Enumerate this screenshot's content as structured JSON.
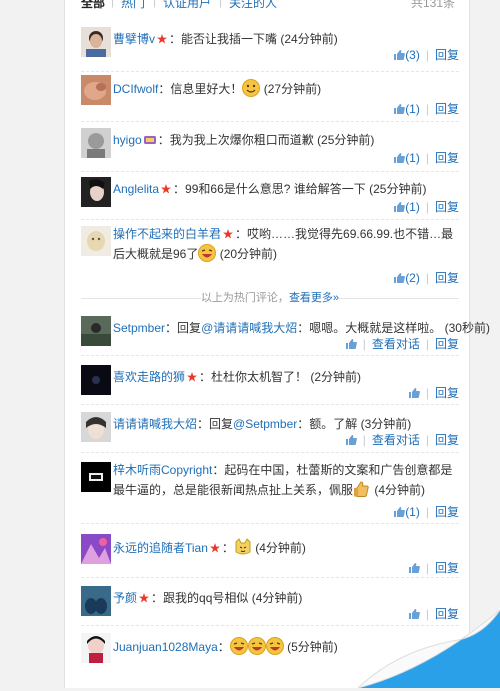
{
  "tabs": [
    {
      "label": "全部",
      "active": true
    },
    {
      "label": "热门",
      "active": false
    },
    {
      "label": "认证用户",
      "active": false
    },
    {
      "label": "关注的人",
      "active": false
    }
  ],
  "total_label": "共131条",
  "hot_divider": {
    "text": "以上为热门评论，",
    "more": "查看更多»"
  },
  "actions": {
    "reply": "回复",
    "view_thread": "查看对话"
  },
  "hot_comments": [
    {
      "user": "曹擘博v",
      "text": "能否让我插一下嘴",
      "time": "(24分钟前)",
      "likes": "(3)"
    },
    {
      "user": "DCIfwolf",
      "text": "信息里好大！",
      "time": "(27分钟前)",
      "likes": "(1)",
      "emoji": "smile"
    },
    {
      "user": "hyigo",
      "text": "我为我上次爆你粗口而道歉",
      "time": "(25分钟前)",
      "likes": "(1)"
    },
    {
      "user": "Anglelita",
      "text": "99和66是什么意思? 谁给解答一下",
      "time": "(25分钟前)",
      "likes": "(1)"
    },
    {
      "user": "操作不起来的白羊君",
      "text": "哎哟……我觉得先69.66.99.也不错…最后大概就是96了",
      "time": "(20分钟前)",
      "likes": "(2)",
      "emoji": "laugh"
    }
  ],
  "comments": [
    {
      "user": "Setpmber",
      "prefix": "回复",
      "mention": "@请请请喊我大炤",
      "text": "嗯嗯。大概就是这样啦。",
      "time": "(30秒前)"
    },
    {
      "user": "喜欢走路的狮",
      "text": "杜杜你太机智了！",
      "time": "(2分钟前)"
    },
    {
      "user": "请请请喊我大炤",
      "prefix": "回复",
      "mention": "@Setpmber",
      "text": "额。了解",
      "time": "(3分钟前)"
    },
    {
      "user": "梓木听雨Copyright",
      "text": "起码在中国，杜蕾斯的文案和广告创意都是最牛逼的，总是能很新闻热点扯上关系，佩服",
      "time": "(4分钟前)",
      "likes": "(1)",
      "emoji": "thumb"
    },
    {
      "user": "永远的追随者Tian",
      "text": "",
      "time": "(4分钟前)",
      "emoji": "cat"
    },
    {
      "user": "予颜",
      "text": "跟我的qq号相似",
      "time": "(4分钟前)"
    },
    {
      "user": "Juanjuan1028Maya",
      "text": "",
      "time": "(5分钟前)",
      "emoji": "laugh3"
    }
  ],
  "colors": {
    "link": "#1f6fb8",
    "vip_star": "#e8392b",
    "divider": "#e6e6e6"
  }
}
